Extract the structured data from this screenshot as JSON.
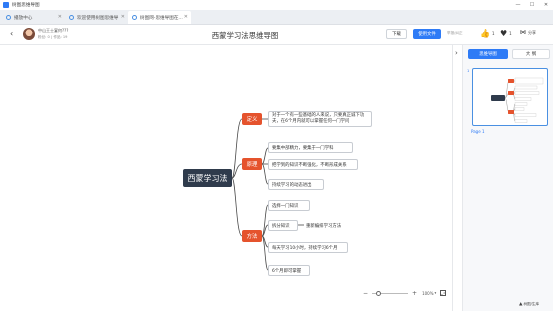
{
  "window": {
    "title": "树图思维导图",
    "controls": [
      "—",
      "☐",
      "✕"
    ]
  },
  "tabs": [
    {
      "label": "播放中心",
      "close": "✕"
    },
    {
      "label": "欢迎使用树图思维导",
      "close": "✕"
    },
    {
      "label": "树图网-思维导图在...",
      "close": "✕"
    }
  ],
  "header": {
    "back": "‹",
    "author_name": "中山王士宴何???",
    "author_meta": "粉丝: 0  |  作品: 19",
    "doc_title": "西蒙学习法思维导图",
    "download_label": "下载",
    "use_label": "使用文件",
    "report_label": "举报/纠正",
    "like_count": "1",
    "favorite_count": "1",
    "share_label": "分享",
    "icons": {
      "like": "thumbs-up-icon",
      "favorite": "heart-icon",
      "share": "share-icon"
    }
  },
  "mindmap": {
    "root": "西蒙学习法",
    "branches": [
      {
        "label": "定义",
        "children": [
          "对于一个有一些基础的人来说，只要真正诚下功夫，在6个月内就可以掌握任何一门学问"
        ]
      },
      {
        "label": "原理",
        "children": [
          "要集中部精力，要集于一门学科",
          "把学到的知识不断强化，不断形成关系",
          "持续学习的动态进出"
        ]
      },
      {
        "label": "方法",
        "children": [
          "选择一门知识",
          "拆分知识",
          "每天学习10小时，持续学习6个月",
          "6个月即可掌握"
        ],
        "sub": "重新编排学习方法"
      }
    ],
    "colors": {
      "root": "#2f3b4c",
      "branch": "#e5532d",
      "line": "#4a4a4a"
    }
  },
  "zoom": {
    "minus": "−",
    "plus": "+",
    "value_label": "100%",
    "level": 0.12,
    "dropdown": "▾",
    "fit": "⤢"
  },
  "panel": {
    "collapse": "›",
    "tab_outline": "思维导图",
    "tab_size": "大 纲",
    "page_number": "1",
    "page_label": "Page 1"
  },
  "watermark": {
    "icon": "▲",
    "text": "树图/生库"
  },
  "accent": "#2e7bf6"
}
